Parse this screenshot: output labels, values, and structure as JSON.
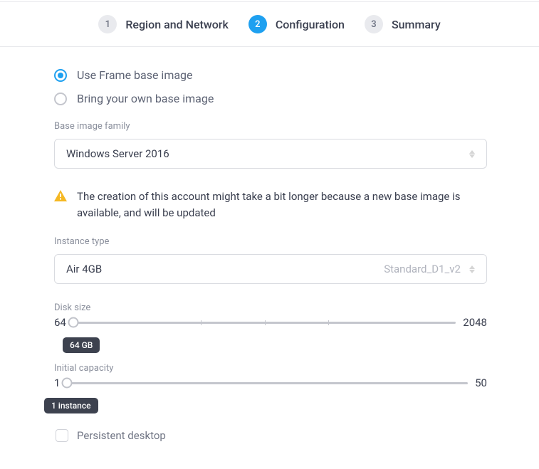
{
  "steps": [
    {
      "num": "1",
      "label": "Region and Network",
      "active": false
    },
    {
      "num": "2",
      "label": "Configuration",
      "active": true
    },
    {
      "num": "3",
      "label": "Summary",
      "active": false
    }
  ],
  "imageSource": {
    "options": [
      {
        "label": "Use Frame base image",
        "selected": true
      },
      {
        "label": "Bring your own base image",
        "selected": false
      }
    ]
  },
  "baseImageFamily": {
    "label": "Base image family",
    "value": "Windows Server 2016"
  },
  "warning": {
    "text": "The creation of this account might take a bit longer because a new base image is available, and will be updated"
  },
  "instanceType": {
    "label": "Instance type",
    "value": "Air 4GB",
    "secondary": "Standard_D1_v2"
  },
  "diskSize": {
    "label": "Disk size",
    "min": "64",
    "max": "2048",
    "badge": "64 GB",
    "valuePct": 0
  },
  "initialCapacity": {
    "label": "Initial capacity",
    "min": "1",
    "max": "50",
    "badge": "1 instance",
    "valuePct": 0
  },
  "persistentDesktop": {
    "label": "Persistent desktop",
    "checked": false
  }
}
